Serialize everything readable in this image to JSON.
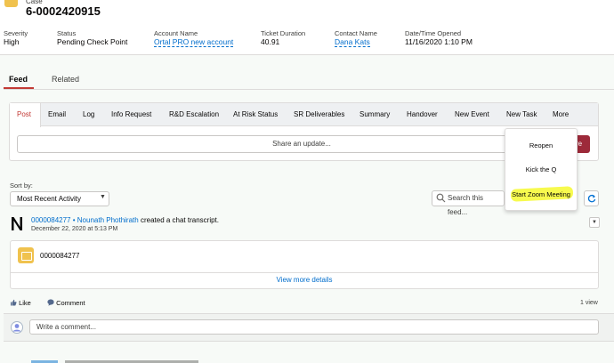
{
  "header": {
    "record_type": "Case",
    "case_number": "6-0002420915",
    "fields": [
      {
        "label": "Severity",
        "value": "High"
      },
      {
        "label": "Status",
        "value": "Pending Check Point"
      },
      {
        "label": "Account Name",
        "value": "Ortal PRO new account"
      },
      {
        "label": "Ticket Duration",
        "value": "40.91"
      },
      {
        "label": "Contact Name",
        "value": "Dana Kats"
      },
      {
        "label": "Date/Time Opened",
        "value": "11/16/2020 1:10 PM"
      }
    ]
  },
  "tabs": {
    "feed": "Feed",
    "related": "Related"
  },
  "publisher": {
    "tabs": [
      "Post",
      "Email",
      "Log",
      "Info Request",
      "R&D Escalation",
      "At Risk Status",
      "SR Deliverables",
      "Summary",
      "Handover",
      "New Event",
      "New Task",
      "More"
    ],
    "share_placeholder": "Share an update...",
    "share_button_peek": "re"
  },
  "more_menu": {
    "items": [
      "Reopen",
      "Kick the Q",
      "Start Zoom Meeting"
    ],
    "highlight_color": "#f6f93b"
  },
  "sort": {
    "label": "Sort by:",
    "value": "Most Recent Activity"
  },
  "search": {
    "placeholder": "Search this feed..."
  },
  "feed_item": {
    "record_link": "0000084277",
    "separator": "•",
    "actor": "Nounath Phothirath",
    "action": "created a chat transcript.",
    "date": "December 22, 2020 at 5:13 PM",
    "attachment_name": "0000084277",
    "view_more": "View more details",
    "like": "Like",
    "comment": "Comment",
    "views": "1 view",
    "comment_placeholder": "Write a comment..."
  },
  "colors": {
    "accent": "#c23934",
    "link": "#006dcc",
    "case_icon": "#f0c24e"
  }
}
